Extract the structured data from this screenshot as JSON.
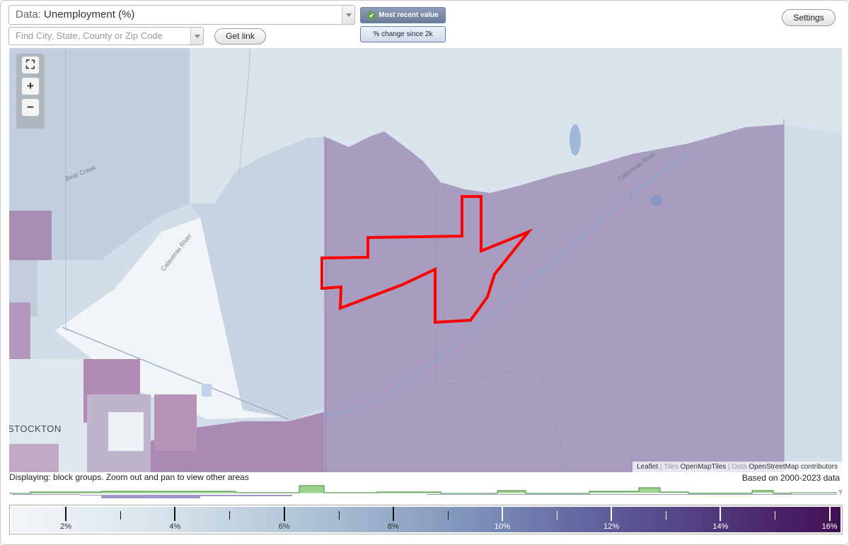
{
  "data_select": {
    "label": "Data:",
    "value": "Unemployment (%)"
  },
  "search": {
    "placeholder": "Find City, State, County or Zip Code"
  },
  "buttons": {
    "get_link": "Get link",
    "settings": "Settings"
  },
  "toggles": {
    "most_recent": "Most recent value",
    "pct_change": "% change since 2k"
  },
  "map": {
    "city_label": "STOCKTON",
    "road_labels": [
      "Bear Creek",
      "Calaveras River",
      "Calaveras River"
    ],
    "attribution": {
      "leaflet": "Leaflet",
      "tiles_prefix": "| Tiles",
      "tiles": "OpenMapTiles",
      "data_prefix": "| Data",
      "data": "OpenStreetMap",
      "suffix": "contributors"
    },
    "zoom": {
      "fullscreen": "⛶",
      "zoom_in": "+",
      "zoom_out": "−"
    },
    "colors": {
      "highlight": "#ff0000",
      "region_purple": "#a99cc0",
      "region_light": "#c9d4e2",
      "region_white": "#f2f6f9"
    }
  },
  "display_note": "Displaying: block groups. Zoom out and pan to view other areas",
  "data_range": "Based on 2000-2023 data",
  "legend": {
    "ticks": [
      "2%",
      "4%",
      "6%",
      "8%",
      "10%",
      "12%",
      "14%",
      "16%"
    ],
    "min": 1,
    "max": 16.2,
    "colors": [
      "#f2f6f9",
      "#a9bfd3",
      "#5d5d99",
      "#420f52"
    ]
  },
  "histogram_question": "?"
}
